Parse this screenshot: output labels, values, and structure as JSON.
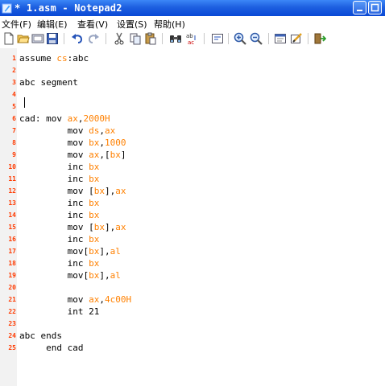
{
  "window": {
    "title": "* 1.asm - Notepad2"
  },
  "menu": [
    {
      "label": "文件(F)"
    },
    {
      "label": "编辑(E)"
    },
    {
      "label": "查看(V)"
    },
    {
      "label": "设置(S)"
    },
    {
      "label": "帮助(H)"
    }
  ],
  "toolbar": [
    "new-icon",
    "open-icon",
    "browse-icon",
    "save-icon",
    "undo-icon",
    "redo-icon",
    "cut-icon",
    "copy-icon",
    "paste-icon",
    "find-icon",
    "replace-icon",
    "word-wrap-icon",
    "zoom-in-icon",
    "zoom-out-icon",
    "select-scheme-icon",
    "customize-icon",
    "exit-icon"
  ],
  "lines": [
    {
      "n": "1",
      "tokens": [
        {
          "t": "assume "
        },
        {
          "t": "cs",
          "c": "reg"
        },
        {
          "t": ":abc"
        }
      ]
    },
    {
      "n": "2",
      "tokens": []
    },
    {
      "n": "3",
      "tokens": [
        {
          "t": "abc segment"
        }
      ]
    },
    {
      "n": "4",
      "tokens": []
    },
    {
      "n": "5",
      "tokens": []
    },
    {
      "n": "6",
      "tokens": [
        {
          "t": "cad: mov "
        },
        {
          "t": "ax",
          "c": "reg"
        },
        {
          "t": ","
        },
        {
          "t": "2000H",
          "c": "num"
        }
      ]
    },
    {
      "n": "7",
      "tokens": [
        {
          "t": "         mov "
        },
        {
          "t": "ds",
          "c": "reg"
        },
        {
          "t": ","
        },
        {
          "t": "ax",
          "c": "reg"
        }
      ]
    },
    {
      "n": "8",
      "tokens": [
        {
          "t": "         mov "
        },
        {
          "t": "bx",
          "c": "reg"
        },
        {
          "t": ","
        },
        {
          "t": "1000",
          "c": "num"
        }
      ]
    },
    {
      "n": "9",
      "tokens": [
        {
          "t": "         mov "
        },
        {
          "t": "ax",
          "c": "reg"
        },
        {
          "t": ",["
        },
        {
          "t": "bx",
          "c": "reg"
        },
        {
          "t": "]"
        }
      ]
    },
    {
      "n": "10",
      "tokens": [
        {
          "t": "         inc "
        },
        {
          "t": "bx",
          "c": "reg"
        }
      ]
    },
    {
      "n": "11",
      "tokens": [
        {
          "t": "         inc "
        },
        {
          "t": "bx",
          "c": "reg"
        }
      ]
    },
    {
      "n": "12",
      "tokens": [
        {
          "t": "         mov ["
        },
        {
          "t": "bx",
          "c": "reg"
        },
        {
          "t": "],"
        },
        {
          "t": "ax",
          "c": "reg"
        }
      ]
    },
    {
      "n": "13",
      "tokens": [
        {
          "t": "         inc "
        },
        {
          "t": "bx",
          "c": "reg"
        }
      ]
    },
    {
      "n": "14",
      "tokens": [
        {
          "t": "         inc "
        },
        {
          "t": "bx",
          "c": "reg"
        }
      ]
    },
    {
      "n": "15",
      "tokens": [
        {
          "t": "         mov ["
        },
        {
          "t": "bx",
          "c": "reg"
        },
        {
          "t": "],"
        },
        {
          "t": "ax",
          "c": "reg"
        }
      ]
    },
    {
      "n": "16",
      "tokens": [
        {
          "t": "         inc "
        },
        {
          "t": "bx",
          "c": "reg"
        }
      ]
    },
    {
      "n": "17",
      "tokens": [
        {
          "t": "         mov["
        },
        {
          "t": "bx",
          "c": "reg"
        },
        {
          "t": "],"
        },
        {
          "t": "al",
          "c": "reg"
        }
      ]
    },
    {
      "n": "18",
      "tokens": [
        {
          "t": "         inc "
        },
        {
          "t": "bx",
          "c": "reg"
        }
      ]
    },
    {
      "n": "19",
      "tokens": [
        {
          "t": "         mov["
        },
        {
          "t": "bx",
          "c": "reg"
        },
        {
          "t": "],"
        },
        {
          "t": "al",
          "c": "reg"
        }
      ]
    },
    {
      "n": "20",
      "tokens": []
    },
    {
      "n": "21",
      "tokens": [
        {
          "t": "         mov "
        },
        {
          "t": "ax",
          "c": "reg"
        },
        {
          "t": ","
        },
        {
          "t": "4c00H",
          "c": "num"
        }
      ]
    },
    {
      "n": "22",
      "tokens": [
        {
          "t": "         int 21"
        }
      ]
    },
    {
      "n": "23",
      "tokens": []
    },
    {
      "n": "24",
      "tokens": [
        {
          "t": "abc ends"
        }
      ]
    },
    {
      "n": "25",
      "tokens": [
        {
          "t": "     end cad"
        }
      ]
    }
  ],
  "colors": {
    "register": "#ff8000",
    "number": "#ff8000",
    "line_number": "#ff3a00",
    "titlebar": "#1d5fe0"
  }
}
